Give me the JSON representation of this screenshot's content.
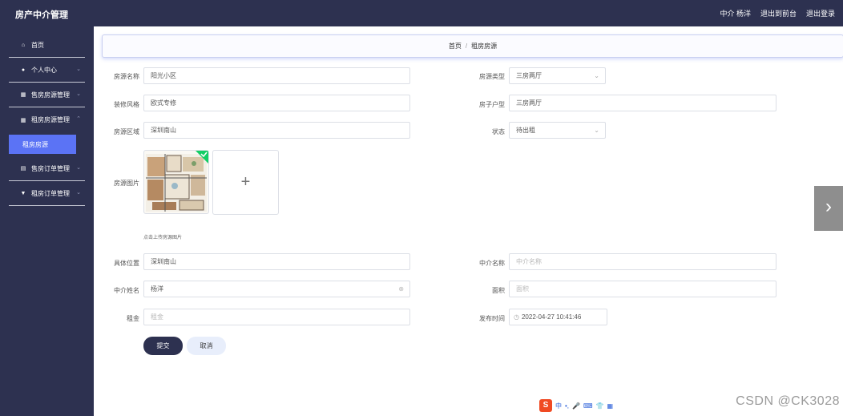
{
  "header": {
    "brand": "房产中介管理",
    "user": "中介 杨洋",
    "back_to_front": "退出到前台",
    "logout": "退出登录"
  },
  "sidebar": {
    "items": [
      {
        "label": "首页",
        "icon": "home-icon",
        "glyph": "⌂"
      },
      {
        "label": "个人中心",
        "icon": "user-icon",
        "glyph": "●"
      },
      {
        "label": "售房房源管理",
        "icon": "grid-icon",
        "glyph": "▦"
      },
      {
        "label": "租房房源管理",
        "icon": "grid-icon",
        "glyph": "▦"
      },
      {
        "label": "租房房源",
        "active": true
      },
      {
        "label": "售房订单管理",
        "icon": "list-icon",
        "glyph": "▤"
      },
      {
        "label": "租房订单管理",
        "icon": "filter-icon",
        "glyph": "▼"
      }
    ]
  },
  "breadcrumb": {
    "home": "首页",
    "sep": "/",
    "current": "租房房源"
  },
  "form": {
    "name": {
      "label": "房源名称",
      "value": "阳光小区"
    },
    "type": {
      "label": "房源类型",
      "value": "三房两厅"
    },
    "style": {
      "label": "装修风格",
      "value": "欧式专修"
    },
    "layout": {
      "label": "房子户型",
      "value": "三房两厅"
    },
    "area_region": {
      "label": "房源区域",
      "value": "深圳南山"
    },
    "status": {
      "label": "状态",
      "value": "待出租"
    },
    "image": {
      "label": "房源图片",
      "hint": "点击上传房源图片"
    },
    "location": {
      "label": "具体位置",
      "value": "深圳南山"
    },
    "agent_name": {
      "label": "中介名称",
      "placeholder": "中介名称"
    },
    "agent_fullname": {
      "label": "中介姓名",
      "value": "杨洋"
    },
    "size": {
      "label": "面积",
      "placeholder": "面积"
    },
    "rent": {
      "label": "租金",
      "placeholder": "租金"
    },
    "publish_time": {
      "label": "发布时间",
      "value": "2022-04-27 10:41:46"
    }
  },
  "buttons": {
    "submit": "提交",
    "cancel": "取消"
  },
  "ime": {
    "items": [
      "中",
      "•,",
      "🎤",
      "⌨",
      "👕",
      "▦"
    ],
    "logo": "S"
  },
  "watermark": "CSDN @CK3028",
  "colors": {
    "sidebar_bg": "#2d3150",
    "accent": "#5b73f5"
  }
}
